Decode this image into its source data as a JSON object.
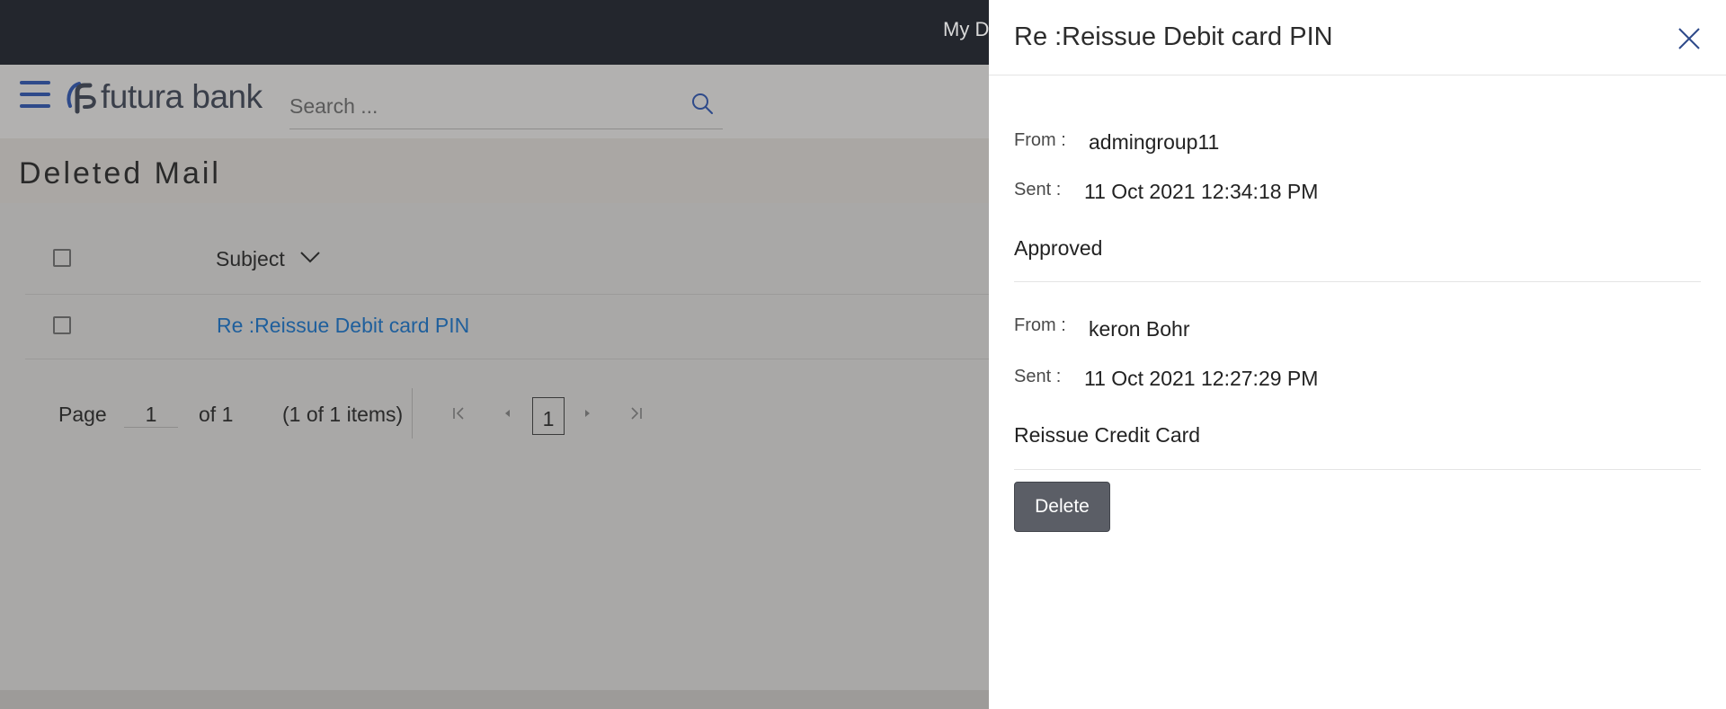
{
  "topbar": {
    "user_link": "My D"
  },
  "header": {
    "logo_text": "futura bank",
    "search": {
      "placeholder": "Search ..."
    }
  },
  "page": {
    "title": "Deleted Mail"
  },
  "table": {
    "column_subject": "Subject",
    "rows": [
      {
        "subject": "Re :Reissue Debit card PIN"
      }
    ]
  },
  "pager": {
    "page_label": "Page",
    "page_value": "1",
    "of_label": "of 1",
    "items_label": "(1 of 1 items)",
    "current_page": "1"
  },
  "drawer": {
    "title": "Re :Reissue Debit card PIN",
    "messages": [
      {
        "from_label": "From :",
        "from": "admingroup11",
        "sent_label": "Sent :",
        "sent": "11 Oct 2021 12:34:18 PM",
        "body": "Approved"
      },
      {
        "from_label": "From :",
        "from": "keron Bohr",
        "sent_label": "Sent :",
        "sent": "11 Oct 2021 12:27:29 PM",
        "body": "Reissue Credit Card"
      }
    ],
    "delete_label": "Delete"
  },
  "colors": {
    "overlay_bg": "#a9a8a7",
    "topbar": "#23262d",
    "link": "#1f5f9c",
    "delete_button": "#5b5e66",
    "brand": "#2e4a8a"
  }
}
